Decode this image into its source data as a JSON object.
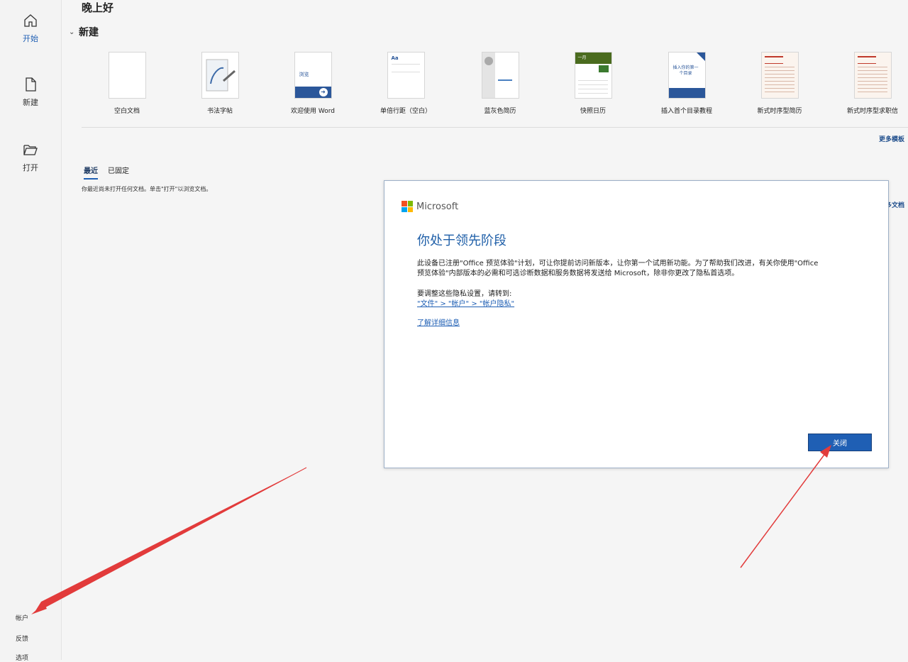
{
  "greeting": "晚上好",
  "sidebar": {
    "items": [
      {
        "label": "开始",
        "icon": "home-icon"
      },
      {
        "label": "新建",
        "icon": "new-document-icon"
      },
      {
        "label": "打开",
        "icon": "open-folder-icon"
      }
    ],
    "bottom": {
      "account": "帐户",
      "feedback": "反馈",
      "options": "选项"
    }
  },
  "new_section": {
    "title": "新建",
    "templates": [
      {
        "label": "空白文档"
      },
      {
        "label": "书法字帖"
      },
      {
        "label": "欢迎使用 Word",
        "thumb_text": "浏览"
      },
      {
        "label": "单倍行距（空白）",
        "thumb_text": "Aa"
      },
      {
        "label": "蓝灰色简历"
      },
      {
        "label": "快照日历",
        "thumb_text": "一月"
      },
      {
        "label": "插入首个目录教程",
        "thumb_text": "插入你的第一个目录"
      },
      {
        "label": "新式时序型简历"
      },
      {
        "label": "新式时序型求职信"
      }
    ],
    "more_templates": "更多模板"
  },
  "recent": {
    "tabs": [
      {
        "label": "最近"
      },
      {
        "label": "已固定"
      }
    ],
    "empty_message": "你最近尚未打开任何文档。单击\"打开\"以浏览文档。",
    "more_documents": "多文档"
  },
  "dialog": {
    "brand": "Microsoft",
    "title": "你处于领先阶段",
    "body": "此设备已注册\"Office 预览体验\"计划，可让你提前访问新版本，让你第一个试用新功能。为了帮助我们改进，有关你使用\"Office 预览体验\"内部版本的必需和可选诊断数据和服务数据将发送给 Microsoft，除非你更改了隐私首选项。",
    "privacy_prompt": "要调整这些隐私设置，请转到:",
    "privacy_link": "\"文件\" > \"帐户\" > \"帐户隐私\"",
    "learn_more": "了解详细信息",
    "close_button": "关闭"
  },
  "colors": {
    "accent": "#1f5fb4",
    "arrow": "#e23b3b",
    "ms_red": "#f25022",
    "ms_green": "#7fba00",
    "ms_blue": "#00a4ef",
    "ms_yellow": "#ffb900"
  }
}
